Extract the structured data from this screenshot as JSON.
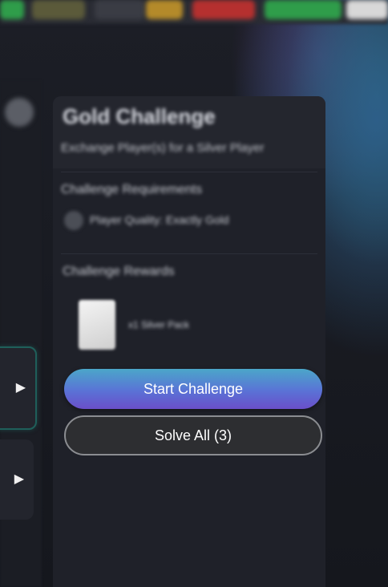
{
  "background": {
    "top_chips": [
      {
        "color": "#2f9d4a"
      },
      {
        "color": "#5b5a3a"
      },
      {
        "color": "#3a3c44"
      },
      {
        "color": "#b48a2a"
      },
      {
        "color": "#b5302f"
      },
      {
        "color": "#2f9d4a"
      },
      {
        "color": "#d8d8d8"
      }
    ]
  },
  "sidebar": {
    "items": [
      {
        "icon": "play-icon",
        "glyph": "▶",
        "active": true
      },
      {
        "icon": "play-icon",
        "glyph": "▶",
        "active": false
      }
    ]
  },
  "challenge": {
    "title": "Gold Challenge",
    "subtitle": "Exchange Player(s) for a Silver Player",
    "requirements_heading": "Challenge Requirements",
    "requirement": "Player Quality: Exactly Gold",
    "rewards_heading": "Challenge Rewards",
    "reward_label": "x1 Silver Pack",
    "start_button": "Start Challenge",
    "solve_all_button": "Solve All (3)"
  },
  "colors": {
    "accent_gradient_start": "#4ba7c9",
    "accent_gradient_end": "#6a4fc9",
    "panel": "#1f2129",
    "active_outline": "#1f5f5a"
  }
}
